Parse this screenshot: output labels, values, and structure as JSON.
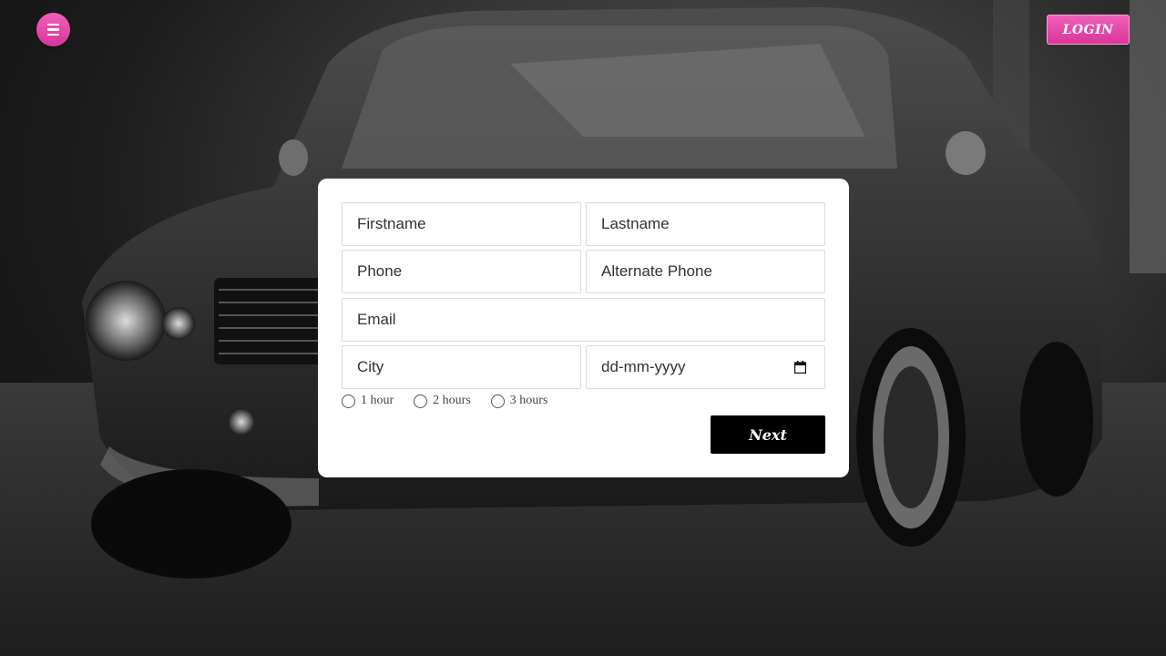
{
  "header": {
    "menu_icon": "hamburger-menu-icon",
    "login_label": "LOGIN"
  },
  "form": {
    "firstname_placeholder": "Firstname",
    "lastname_placeholder": "Lastname",
    "phone_placeholder": "Phone",
    "alt_phone_placeholder": "Alternate Phone",
    "email_placeholder": "Email",
    "city_placeholder": "City",
    "date_placeholder": "dd-mm-yyyy",
    "date_icon": "calendar-icon",
    "duration_options": [
      "1 hour",
      "2 hours",
      "3 hours"
    ],
    "next_label": "Next"
  },
  "colors": {
    "accent": "#e94bb0",
    "button_dark": "#000000",
    "card": "#ffffff"
  }
}
